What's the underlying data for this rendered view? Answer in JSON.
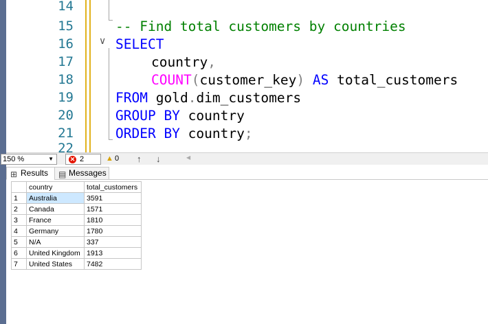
{
  "editor": {
    "line_numbers": [
      "14",
      "15",
      "16",
      "17",
      "18",
      "19",
      "20",
      "21",
      "22"
    ],
    "fold_toggle": "∨",
    "code": {
      "comment": "-- Find total customers by countries",
      "select": "SELECT",
      "col_country": "country",
      "comma": ",",
      "fn_count": "COUNT",
      "paren_open": "(",
      "arg": "customer_key",
      "paren_close": ")",
      "as_kw": "AS",
      "alias": "total_customers",
      "from_kw": "FROM",
      "schema": "gold",
      "dot": ".",
      "table": "dim_customers",
      "group_kw": "GROUP BY",
      "group_col": "country",
      "order_kw": "ORDER BY",
      "order_col": "country",
      "semicolon": ";"
    }
  },
  "status": {
    "zoom": "150 %",
    "errors": "2",
    "warnings": "0",
    "icons": {
      "error": "error-circle-icon",
      "warning": "warning-triangle-icon",
      "up": "arrow-up-icon",
      "down": "arrow-down-icon"
    }
  },
  "tabs": [
    {
      "label": "Results",
      "icon": "grid-icon"
    },
    {
      "label": "Messages",
      "icon": "message-icon"
    }
  ],
  "results": {
    "columns": [
      "country",
      "total_customers"
    ],
    "rows": [
      {
        "n": "1",
        "country": "Australia",
        "total": "3591"
      },
      {
        "n": "2",
        "country": "Canada",
        "total": "1571"
      },
      {
        "n": "3",
        "country": "France",
        "total": "1810"
      },
      {
        "n": "4",
        "country": "Germany",
        "total": "1780"
      },
      {
        "n": "5",
        "country": "N/A",
        "total": "337"
      },
      {
        "n": "6",
        "country": "United Kingdom",
        "total": "1913"
      },
      {
        "n": "7",
        "country": "United States",
        "total": "7482"
      }
    ]
  },
  "colors": {
    "keyword": "#0000ff",
    "function": "#ff00ff",
    "comment": "#008000",
    "line_number": "#237893",
    "selection": "#cde8ff"
  }
}
